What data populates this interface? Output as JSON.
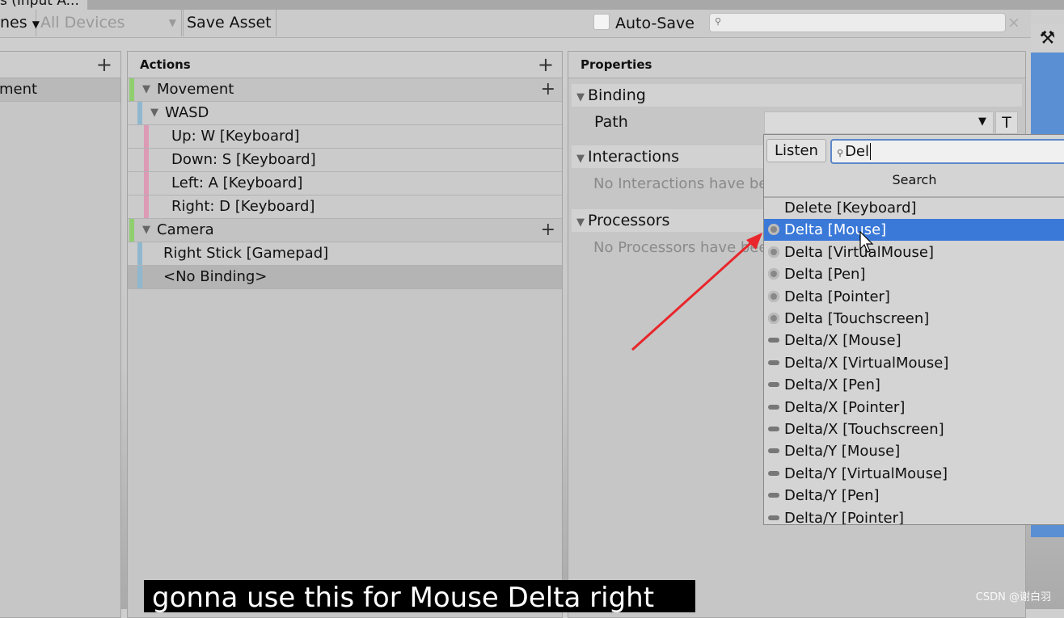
{
  "window": {
    "tab_title": "s (Input A..."
  },
  "toolbar": {
    "schemes_label": "nes",
    "devices_label": "All Devices",
    "save_asset": "Save Asset",
    "auto_save": "Auto-Save",
    "search_placeholder": "",
    "clear": "×"
  },
  "maps_panel": {
    "selected": "ment"
  },
  "actions_panel": {
    "title": "Actions",
    "rows": [
      {
        "label": "Movement",
        "type": "action",
        "color": "#8fcf6f"
      },
      {
        "label": "WASD",
        "type": "composite",
        "color": "#8fb8cf"
      },
      {
        "label": "Up: W [Keyboard]",
        "type": "part",
        "color": "#dc9ab4"
      },
      {
        "label": "Down: S [Keyboard]",
        "type": "part",
        "color": "#dc9ab4"
      },
      {
        "label": "Left: A [Keyboard]",
        "type": "part",
        "color": "#dc9ab4"
      },
      {
        "label": "Right: D [Keyboard]",
        "type": "part",
        "color": "#dc9ab4"
      },
      {
        "label": "Camera",
        "type": "action",
        "color": "#8fcf6f"
      },
      {
        "label": "Right Stick [Gamepad]",
        "type": "binding",
        "color": "#8fb8cf"
      },
      {
        "label": "<No Binding>",
        "type": "binding",
        "color": "#8fb8cf",
        "selected": true
      }
    ]
  },
  "properties_panel": {
    "title": "Properties",
    "binding": "Binding",
    "path_label": "Path",
    "t_button": "T",
    "interactions": "Interactions",
    "interactions_empty": "No Interactions have bee",
    "processors": "Processors",
    "processors_empty": "No Processors have bee"
  },
  "dropdown": {
    "listen": "Listen",
    "search_value": "Del",
    "search_header": "Search",
    "items": [
      {
        "label": "Delete [Keyboard]",
        "icon": "none"
      },
      {
        "label": "Delta [Mouse]",
        "icon": "vector2",
        "selected": true
      },
      {
        "label": "Delta [VirtualMouse]",
        "icon": "vector2"
      },
      {
        "label": "Delta [Pen]",
        "icon": "vector2"
      },
      {
        "label": "Delta [Pointer]",
        "icon": "vector2"
      },
      {
        "label": "Delta [Touchscreen]",
        "icon": "vector2"
      },
      {
        "label": "Delta/X [Mouse]",
        "icon": "axis"
      },
      {
        "label": "Delta/X [VirtualMouse]",
        "icon": "axis"
      },
      {
        "label": "Delta/X [Pen]",
        "icon": "axis"
      },
      {
        "label": "Delta/X [Pointer]",
        "icon": "axis"
      },
      {
        "label": "Delta/X [Touchscreen]",
        "icon": "axis"
      },
      {
        "label": "Delta/Y [Mouse]",
        "icon": "axis"
      },
      {
        "label": "Delta/Y [VirtualMouse]",
        "icon": "axis"
      },
      {
        "label": "Delta/Y [Pen]",
        "icon": "axis"
      },
      {
        "label": "Delta/Y [Pointer]",
        "icon": "axis"
      }
    ]
  },
  "subtitle": "gonna use this for Mouse Delta right",
  "watermark": "CSDN @谢白羽",
  "accent": "#3a79d8",
  "arrow_color": "#e8262b"
}
